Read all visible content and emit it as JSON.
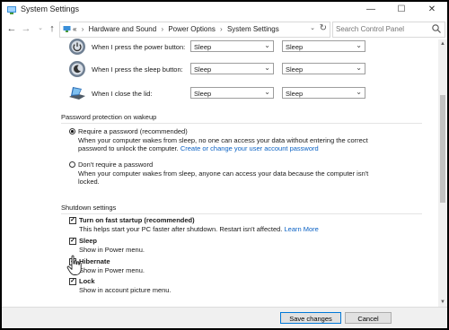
{
  "window": {
    "title": "System Settings",
    "minimize": "—",
    "maximize": "☐",
    "close": "✕"
  },
  "nav": {
    "breadcrumbs": [
      "Hardware and Sound",
      "Power Options",
      "System Settings"
    ],
    "overflow": "«",
    "search_placeholder": "Search Control Panel"
  },
  "power_rows": [
    {
      "label": "When I press the power button:",
      "icon": "power-button-icon",
      "on_battery": "Sleep",
      "plugged_in": "Sleep"
    },
    {
      "label": "When I press the sleep button:",
      "icon": "sleep-button-icon",
      "on_battery": "Sleep",
      "plugged_in": "Sleep"
    },
    {
      "label": "When I close the lid:",
      "icon": "laptop-lid-icon",
      "on_battery": "Sleep",
      "plugged_in": "Sleep"
    }
  ],
  "password": {
    "title": "Password protection on wakeup",
    "require": {
      "label": "Require a password (recommended)",
      "desc_line1": "When your computer wakes from sleep, no one can access your data without entering the correct",
      "desc_line2": "password to unlock the computer.",
      "link": "Create or change your user account password",
      "selected": true
    },
    "dont": {
      "label": "Don't require a password",
      "desc_line1": "When your computer wakes from sleep, anyone can access your data because the computer isn't",
      "desc_line2": "locked.",
      "selected": false
    }
  },
  "shutdown": {
    "title": "Shutdown settings",
    "items": [
      {
        "label": "Turn on fast startup (recommended)",
        "desc": "This helps start your PC faster after shutdown. Restart isn't affected.",
        "link": "Learn More",
        "checked": true
      },
      {
        "label": "Sleep",
        "desc": "Show in Power menu.",
        "checked": true
      },
      {
        "label": "Hibernate",
        "desc": "Show in Power menu.",
        "checked": true
      },
      {
        "label": "Lock",
        "desc": "Show in account picture menu.",
        "checked": true
      }
    ]
  },
  "footer": {
    "save": "Save changes",
    "cancel": "Cancel"
  },
  "colors": {
    "link": "#0b62c4",
    "accent": "#0078d7"
  }
}
